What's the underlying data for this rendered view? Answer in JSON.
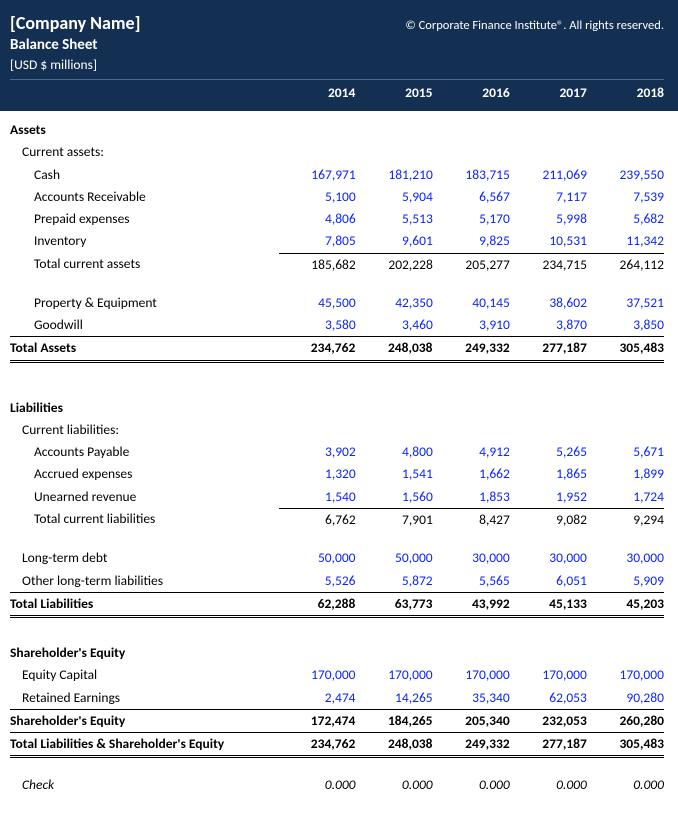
{
  "header": {
    "company_name": "[Company Name]",
    "copyright": "© Corporate Finance Institute®. All rights reserved.",
    "subtitle": "Balance Sheet",
    "units": "[USD $ millions]"
  },
  "years": [
    "2014",
    "2015",
    "2016",
    "2017",
    "2018"
  ],
  "assets": {
    "title": "Assets",
    "current_label": "Current assets:",
    "cash": {
      "label": "Cash",
      "v": [
        "167,971",
        "181,210",
        "183,715",
        "211,069",
        "239,550"
      ]
    },
    "ar": {
      "label": "Accounts Receivable",
      "v": [
        "5,100",
        "5,904",
        "6,567",
        "7,117",
        "7,539"
      ]
    },
    "prepaid": {
      "label": "Prepaid expenses",
      "v": [
        "4,806",
        "5,513",
        "5,170",
        "5,998",
        "5,682"
      ]
    },
    "inventory": {
      "label": "Inventory",
      "v": [
        "7,805",
        "9,601",
        "9,825",
        "10,531",
        "11,342"
      ]
    },
    "total_current": {
      "label": "Total current assets",
      "v": [
        "185,682",
        "202,228",
        "205,277",
        "234,715",
        "264,112"
      ]
    },
    "ppe": {
      "label": "Property & Equipment",
      "v": [
        "45,500",
        "42,350",
        "40,145",
        "38,602",
        "37,521"
      ]
    },
    "goodwill": {
      "label": "Goodwill",
      "v": [
        "3,580",
        "3,460",
        "3,910",
        "3,870",
        "3,850"
      ]
    },
    "total": {
      "label": "Total Assets",
      "v": [
        "234,762",
        "248,038",
        "249,332",
        "277,187",
        "305,483"
      ]
    }
  },
  "liabilities": {
    "title": "Liabilities",
    "current_label": "Current liabilities:",
    "ap": {
      "label": "Accounts Payable",
      "v": [
        "3,902",
        "4,800",
        "4,912",
        "5,265",
        "5,671"
      ]
    },
    "accrued": {
      "label": "Accrued expenses",
      "v": [
        "1,320",
        "1,541",
        "1,662",
        "1,865",
        "1,899"
      ]
    },
    "unearned": {
      "label": "Unearned revenue",
      "v": [
        "1,540",
        "1,560",
        "1,853",
        "1,952",
        "1,724"
      ]
    },
    "total_current": {
      "label": "Total current liabilities",
      "v": [
        "6,762",
        "7,901",
        "8,427",
        "9,082",
        "9,294"
      ]
    },
    "ltd": {
      "label": "Long-term debt",
      "v": [
        "50,000",
        "50,000",
        "30,000",
        "30,000",
        "30,000"
      ]
    },
    "other_lt": {
      "label": "Other long-term liabilities",
      "v": [
        "5,526",
        "5,872",
        "5,565",
        "6,051",
        "5,909"
      ]
    },
    "total": {
      "label": "Total Liabilities",
      "v": [
        "62,288",
        "63,773",
        "43,992",
        "45,133",
        "45,203"
      ]
    }
  },
  "equity": {
    "title": "Shareholder's Equity",
    "capital": {
      "label": "Equity Capital",
      "v": [
        "170,000",
        "170,000",
        "170,000",
        "170,000",
        "170,000"
      ]
    },
    "retained": {
      "label": "Retained Earnings",
      "v": [
        "2,474",
        "14,265",
        "35,340",
        "62,053",
        "90,280"
      ]
    },
    "total": {
      "label": "Shareholder's Equity",
      "v": [
        "172,474",
        "184,265",
        "205,340",
        "232,053",
        "260,280"
      ]
    },
    "total_le": {
      "label": "Total Liabilities & Shareholder's Equity",
      "v": [
        "234,762",
        "248,038",
        "249,332",
        "277,187",
        "305,483"
      ]
    }
  },
  "check": {
    "label": "Check",
    "v": [
      "0.000",
      "0.000",
      "0.000",
      "0.000",
      "0.000"
    ]
  },
  "chart_data": {
    "type": "table",
    "title": "Balance Sheet",
    "units": "USD $ millions",
    "years": [
      2014,
      2015,
      2016,
      2017,
      2018
    ],
    "assets": {
      "current": {
        "Cash": [
          167971,
          181210,
          183715,
          211069,
          239550
        ],
        "Accounts Receivable": [
          5100,
          5904,
          6567,
          7117,
          7539
        ],
        "Prepaid expenses": [
          4806,
          5513,
          5170,
          5998,
          5682
        ],
        "Inventory": [
          7805,
          9601,
          9825,
          10531,
          11342
        ],
        "Total current assets": [
          185682,
          202228,
          205277,
          234715,
          264112
        ]
      },
      "Property & Equipment": [
        45500,
        42350,
        40145,
        38602,
        37521
      ],
      "Goodwill": [
        3580,
        3460,
        3910,
        3870,
        3850
      ],
      "Total Assets": [
        234762,
        248038,
        249332,
        277187,
        305483
      ]
    },
    "liabilities": {
      "current": {
        "Accounts Payable": [
          3902,
          4800,
          4912,
          5265,
          5671
        ],
        "Accrued expenses": [
          1320,
          1541,
          1662,
          1865,
          1899
        ],
        "Unearned revenue": [
          1540,
          1560,
          1853,
          1952,
          1724
        ],
        "Total current liabilities": [
          6762,
          7901,
          8427,
          9082,
          9294
        ]
      },
      "Long-term debt": [
        50000,
        50000,
        30000,
        30000,
        30000
      ],
      "Other long-term liabilities": [
        5526,
        5872,
        5565,
        6051,
        5909
      ],
      "Total Liabilities": [
        62288,
        63773,
        43992,
        45133,
        45203
      ]
    },
    "equity": {
      "Equity Capital": [
        170000,
        170000,
        170000,
        170000,
        170000
      ],
      "Retained Earnings": [
        2474,
        14265,
        35340,
        62053,
        90280
      ],
      "Shareholder's Equity": [
        172474,
        184265,
        205340,
        232053,
        260280
      ],
      "Total Liabilities & Shareholder's Equity": [
        234762,
        248038,
        249332,
        277187,
        305483
      ]
    },
    "check": [
      0.0,
      0.0,
      0.0,
      0.0,
      0.0
    ]
  }
}
